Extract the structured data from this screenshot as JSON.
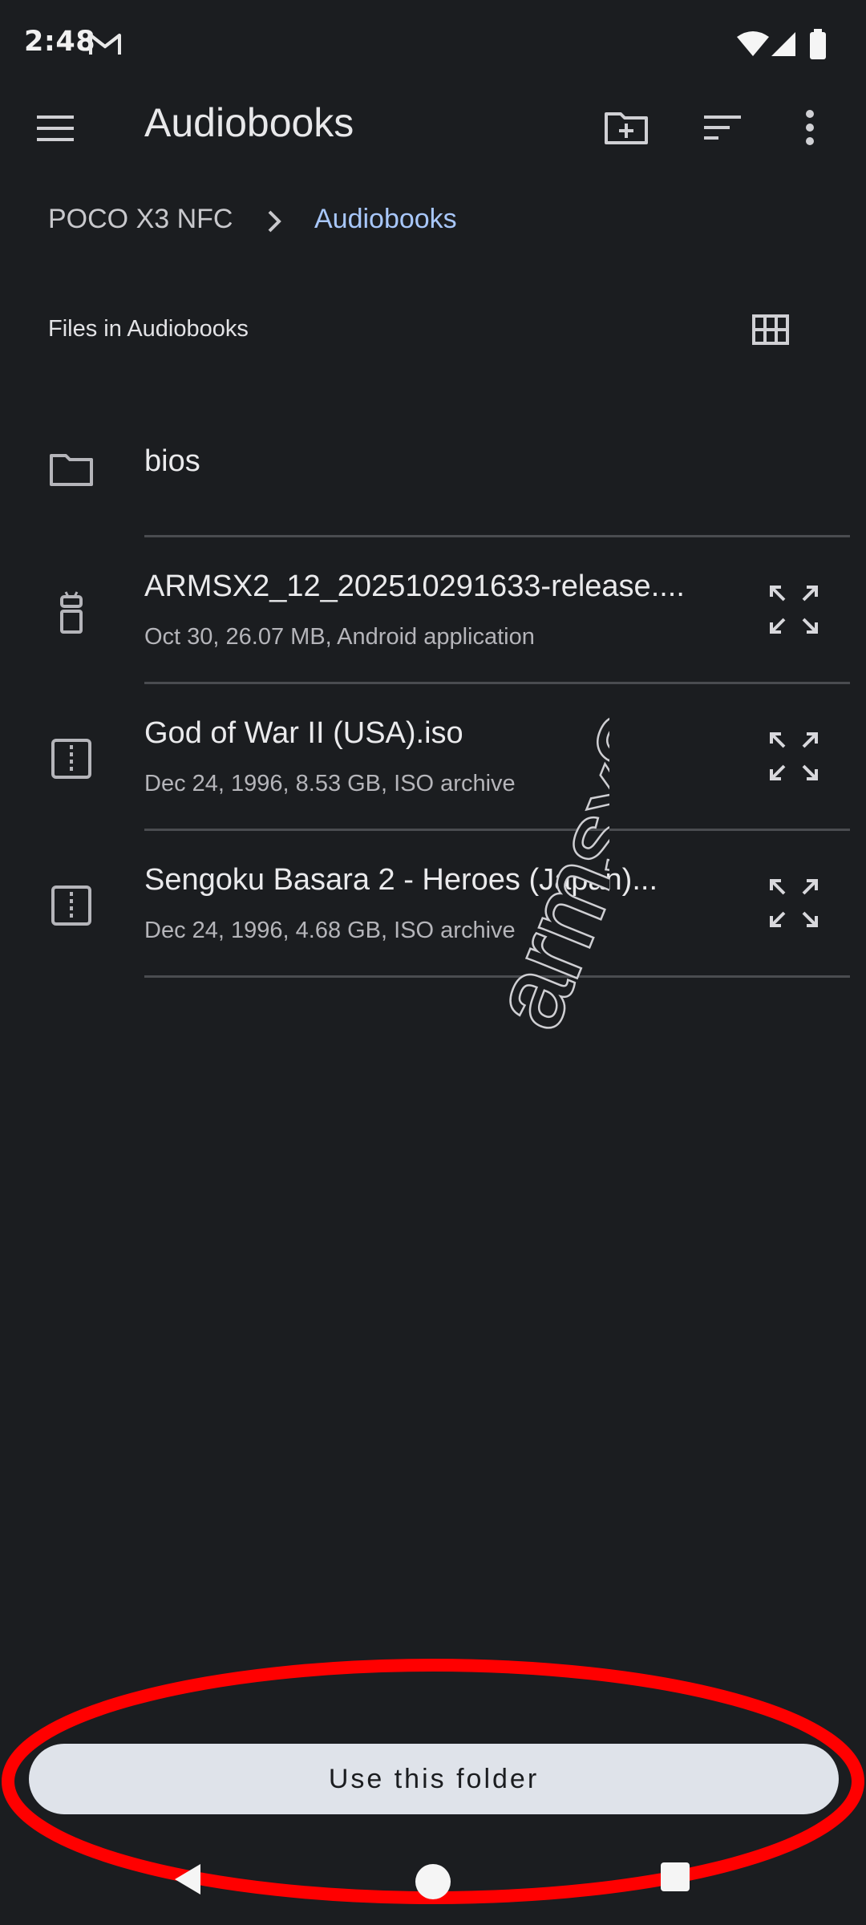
{
  "status_bar": {
    "time": "2:48",
    "icons": [
      "gmail-icon",
      "wifi-icon",
      "signal-icon",
      "battery-icon"
    ]
  },
  "app_bar": {
    "title": "Audiobooks",
    "actions": [
      "new-folder-icon",
      "sort-icon",
      "more-vert-icon"
    ]
  },
  "breadcrumb": {
    "root": "POCO X3 NFC",
    "current": "Audiobooks"
  },
  "section": {
    "title": "Files in Audiobooks"
  },
  "files": [
    {
      "name": "bios",
      "meta": "",
      "icon": "folder-icon"
    },
    {
      "name": "ARMSX2_12_202510291633-release....",
      "meta": "Oct 30, 26.07 MB, Android application",
      "icon": "android-app-icon"
    },
    {
      "name": "God of War II (USA).iso",
      "meta": "Dec 24, 1996, 8.53 GB, ISO archive",
      "icon": "archive-icon"
    },
    {
      "name": "Sengoku Basara 2 - Heroes (Japan)...",
      "meta": "Dec 24, 1996, 4.68 GB, ISO archive",
      "icon": "archive-icon"
    }
  ],
  "watermark": "armsx2.org",
  "bottom": {
    "use_folder_label": "Use this folder"
  },
  "colors": {
    "background": "#1b1d20",
    "accent": "#a8c7fa",
    "button": "#dfe3ea",
    "annotation": "#ff0000"
  }
}
